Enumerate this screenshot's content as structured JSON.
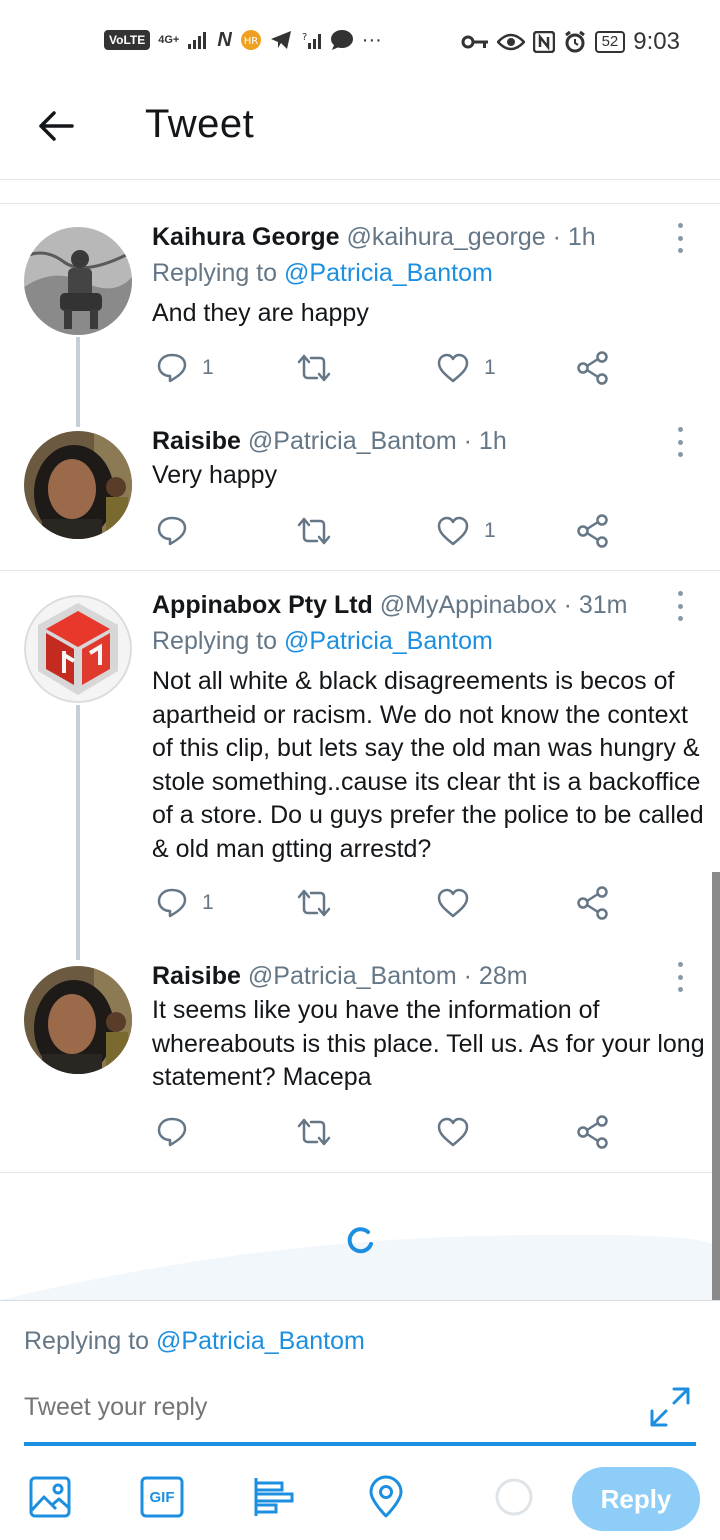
{
  "status_bar": {
    "volte": "VoLTE",
    "network": "4G+",
    "battery": "52",
    "time": "9:03"
  },
  "header": {
    "title": "Tweet",
    "back_icon": "arrow-left-icon"
  },
  "tweets": [
    {
      "name": "Kaihura George",
      "handle": "@kaihura_george",
      "time": "· 1h",
      "replying_prefix": "Replying to ",
      "replying_to": "@Patricia_Bantom",
      "text": "And they are happy",
      "reply_count": "1",
      "retweet_count": "",
      "like_count": "1"
    },
    {
      "name": "Raisibe",
      "handle": "@Patricia_Bantom",
      "time": "· 1h",
      "text": "Very happy",
      "reply_count": "",
      "retweet_count": "",
      "like_count": "1"
    },
    {
      "name": "Appinabox Pty Ltd",
      "handle": "@MyAppinabox",
      "time": "· 31m",
      "replying_prefix": "Replying to ",
      "replying_to": "@Patricia_Bantom",
      "text": "Not all white & black disagreements is becos of apartheid or racism. We do not know the context of this clip, but lets say the old man was hungry & stole something..cause its clear tht is a backoffice of a store. Do u guys prefer the police to be called & old man gtting arrestd?",
      "reply_count": "1",
      "retweet_count": "",
      "like_count": ""
    },
    {
      "name": "Raisibe",
      "handle": "@Patricia_Bantom",
      "time": "· 28m",
      "text": "It seems like you have the information of whereabouts is this place. Tell us. As for your long statement? Macepa",
      "reply_count": "",
      "retweet_count": "",
      "like_count": ""
    }
  ],
  "composer": {
    "replying_prefix": "Replying to ",
    "replying_to": "@Patricia_Bantom",
    "placeholder": "Tweet your reply",
    "gif_label": "GIF",
    "reply_label": "Reply"
  },
  "colors": {
    "accent": "#1d8fe1",
    "reply_button": "#8ecdf7",
    "muted": "#657786",
    "text": "#14171a"
  }
}
